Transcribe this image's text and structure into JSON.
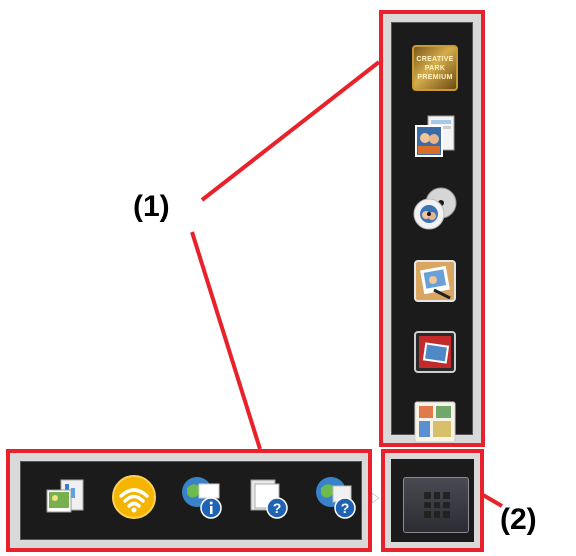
{
  "callouts": {
    "label_1": "(1)",
    "label_2": "(2)"
  },
  "vertical_menu": {
    "items": [
      {
        "name": "creative-park-premium",
        "text": "CREATIVE PARK PREMIUM"
      },
      {
        "name": "photo-layout"
      },
      {
        "name": "disc-label"
      },
      {
        "name": "photo-print"
      },
      {
        "name": "red-album"
      },
      {
        "name": "collage"
      }
    ],
    "colors": {
      "highlight": "#e8212b",
      "panel": "#1b1b1b"
    }
  },
  "horizontal_menu": {
    "items": [
      {
        "name": "my-image-garden"
      },
      {
        "name": "wireless-setup"
      },
      {
        "name": "online-info"
      },
      {
        "name": "help"
      },
      {
        "name": "online-help"
      }
    ]
  },
  "expand_button": {
    "icon": "grid-icon"
  }
}
